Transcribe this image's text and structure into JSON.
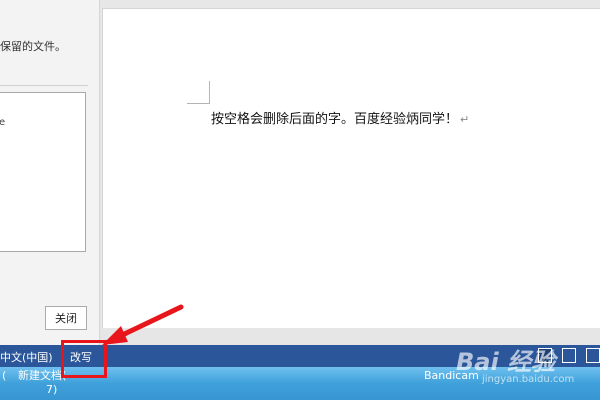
{
  "left_panel": {
    "message": "保留的文件。",
    "list_item": "e",
    "close_label": "关闭"
  },
  "document": {
    "text": "按空格会删除后面的字。百度经验炳同学！",
    "paragraph_mark": "↵"
  },
  "status_bar": {
    "language": "中文(中国)",
    "edit_mode": "改写",
    "view_icons": [
      "read-mode-icon",
      "print-layout-icon",
      "web-layout-icon"
    ]
  },
  "taskbar": {
    "paren": "(",
    "doc_item_line1": "新建文档(",
    "doc_item_line2": "7)",
    "bandicam_item": "Bandicam"
  },
  "watermark": {
    "logo": "Bai 经验",
    "url": "jingyan.baidu.com"
  },
  "colors": {
    "status_bar": "#2b579a",
    "highlight": "#e8161b"
  }
}
